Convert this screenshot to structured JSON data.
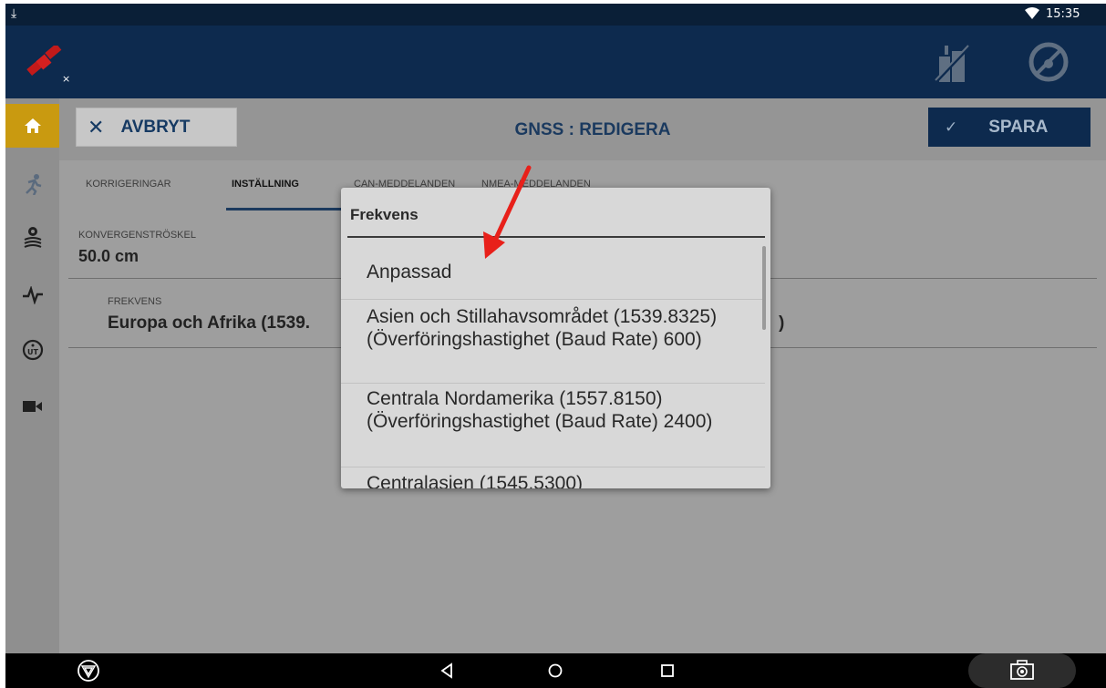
{
  "status_bar": {
    "time": "15:35"
  },
  "header": {
    "cancel_label": "AVBRYT",
    "title": "GNSS : REDIGERA",
    "save_label": "SPARA"
  },
  "tabs": [
    {
      "label": "KORRIGERINGAR",
      "active": false
    },
    {
      "label": "INSTÄLLNING",
      "active": true
    },
    {
      "label": "CAN-MEDDELANDEN",
      "active": false
    },
    {
      "label": "NMEA-MEDDELANDEN",
      "active": false
    }
  ],
  "fields": {
    "convergence": {
      "label": "KONVERGENSTRÖSKEL",
      "value": "50.0 cm"
    },
    "frequency": {
      "label": "FREKVENS",
      "value": "Europa och Afrika (1539.",
      "value_tail": ")"
    }
  },
  "dialog": {
    "title": "Frekvens",
    "options": [
      {
        "label": "Anpassad"
      },
      {
        "label": "Asien och Stillahavsområdet (1539.8325) (Överföringshastighet (Baud Rate) 600)"
      },
      {
        "label": "Centrala Nordamerika (1557.8150) (Överföringshastighet (Baud Rate) 2400)"
      },
      {
        "label": "Centralasien (1545.5300)"
      }
    ]
  },
  "colors": {
    "accent_dark": "#0d2a4e",
    "nav_active": "#c99a10",
    "annotation_arrow": "#e8201a"
  }
}
